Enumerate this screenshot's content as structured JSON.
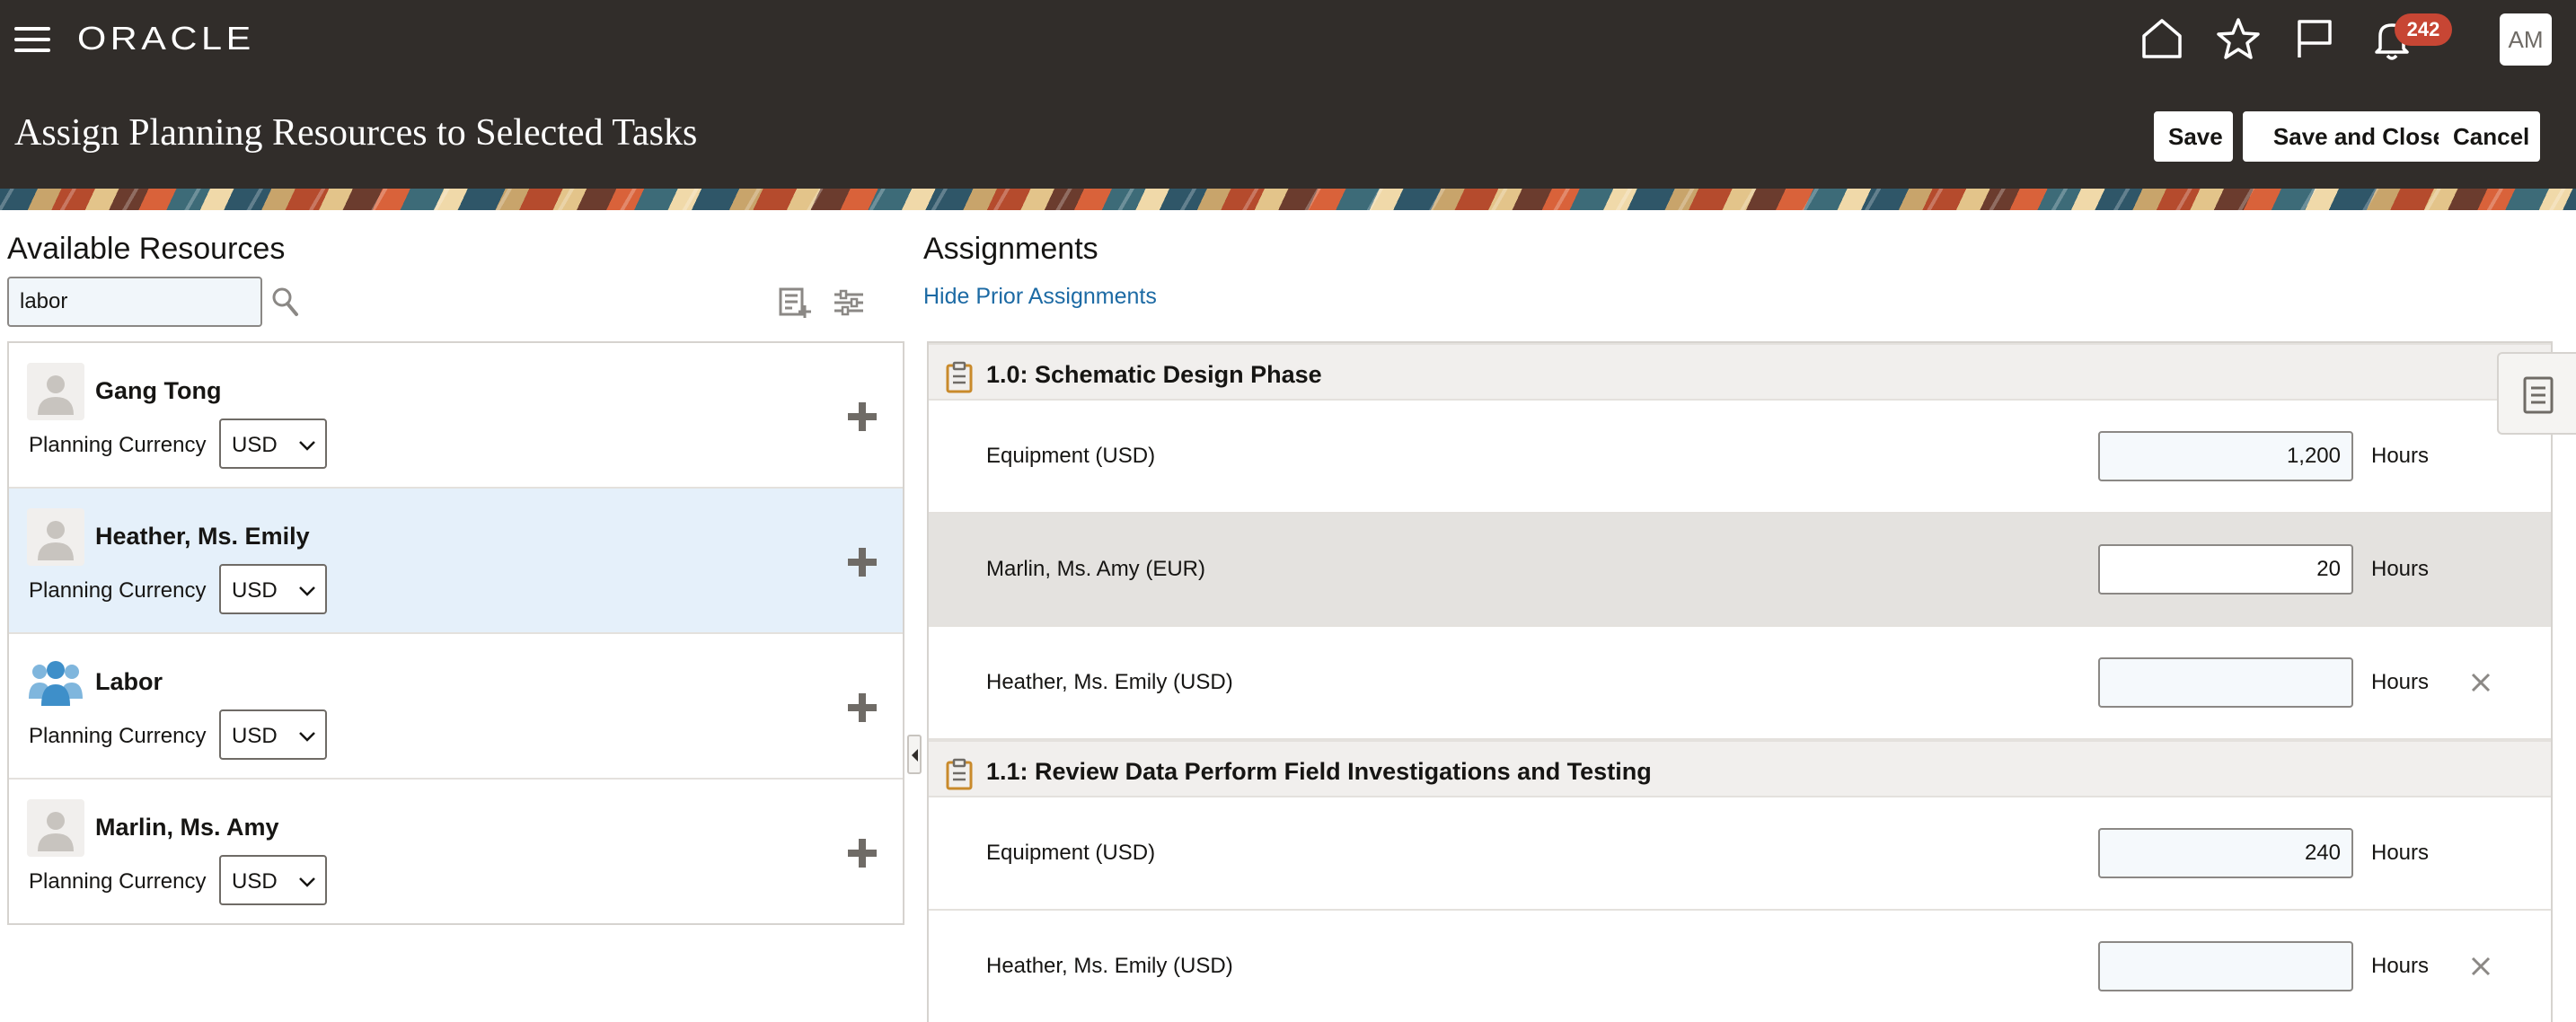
{
  "header": {
    "logo": "ORACLE",
    "notification_count": "242",
    "user_initials": "AM",
    "page_title": "Assign Planning Resources to Selected Tasks",
    "buttons": {
      "save": "Save",
      "save_and_close": "Save and Close",
      "cancel": "Cancel"
    },
    "icons": [
      "hamburger-menu-icon",
      "home-icon",
      "star-icon",
      "flag-icon",
      "bell-icon"
    ]
  },
  "available_resources": {
    "title": "Available Resources",
    "search_value": "labor",
    "items": [
      {
        "name": "Gang Tong",
        "currency_label": "Planning Currency",
        "currency": "USD",
        "avatar": "person-icon"
      },
      {
        "name": "Heather, Ms. Emily",
        "currency_label": "Planning Currency",
        "currency": "USD",
        "avatar": "person-icon",
        "selected": true
      },
      {
        "name": "Labor",
        "currency_label": "Planning Currency",
        "currency": "USD",
        "avatar": "group-icon"
      },
      {
        "name": "Marlin, Ms. Amy",
        "currency_label": "Planning Currency",
        "currency": "USD",
        "avatar": "person-icon"
      }
    ]
  },
  "assignments": {
    "title": "Assignments",
    "hide_link": "Hide Prior Assignments",
    "tasks": [
      {
        "title": "1.0: Schematic Design Phase",
        "rows": [
          {
            "name": "Equipment (USD)",
            "value": "1,200",
            "unit": "Hours",
            "removable": false
          },
          {
            "name": "Marlin, Ms. Amy (EUR)",
            "value": "20",
            "unit": "Hours",
            "removable": false
          },
          {
            "name": "Heather, Ms. Emily (USD)",
            "value": "",
            "unit": "Hours",
            "removable": true
          }
        ]
      },
      {
        "title": "1.1: Review Data Perform Field Investigations and Testing",
        "rows": [
          {
            "name": "Equipment (USD)",
            "value": "240",
            "unit": "Hours",
            "removable": false
          },
          {
            "name": "Heather, Ms. Emily (USD)",
            "value": "",
            "unit": "Hours",
            "removable": true
          }
        ]
      }
    ]
  },
  "colors": {
    "header_bg": "#312d2a",
    "badge": "#c74634",
    "link": "#1c6aa4",
    "selected_row": "#e5f0fa"
  }
}
